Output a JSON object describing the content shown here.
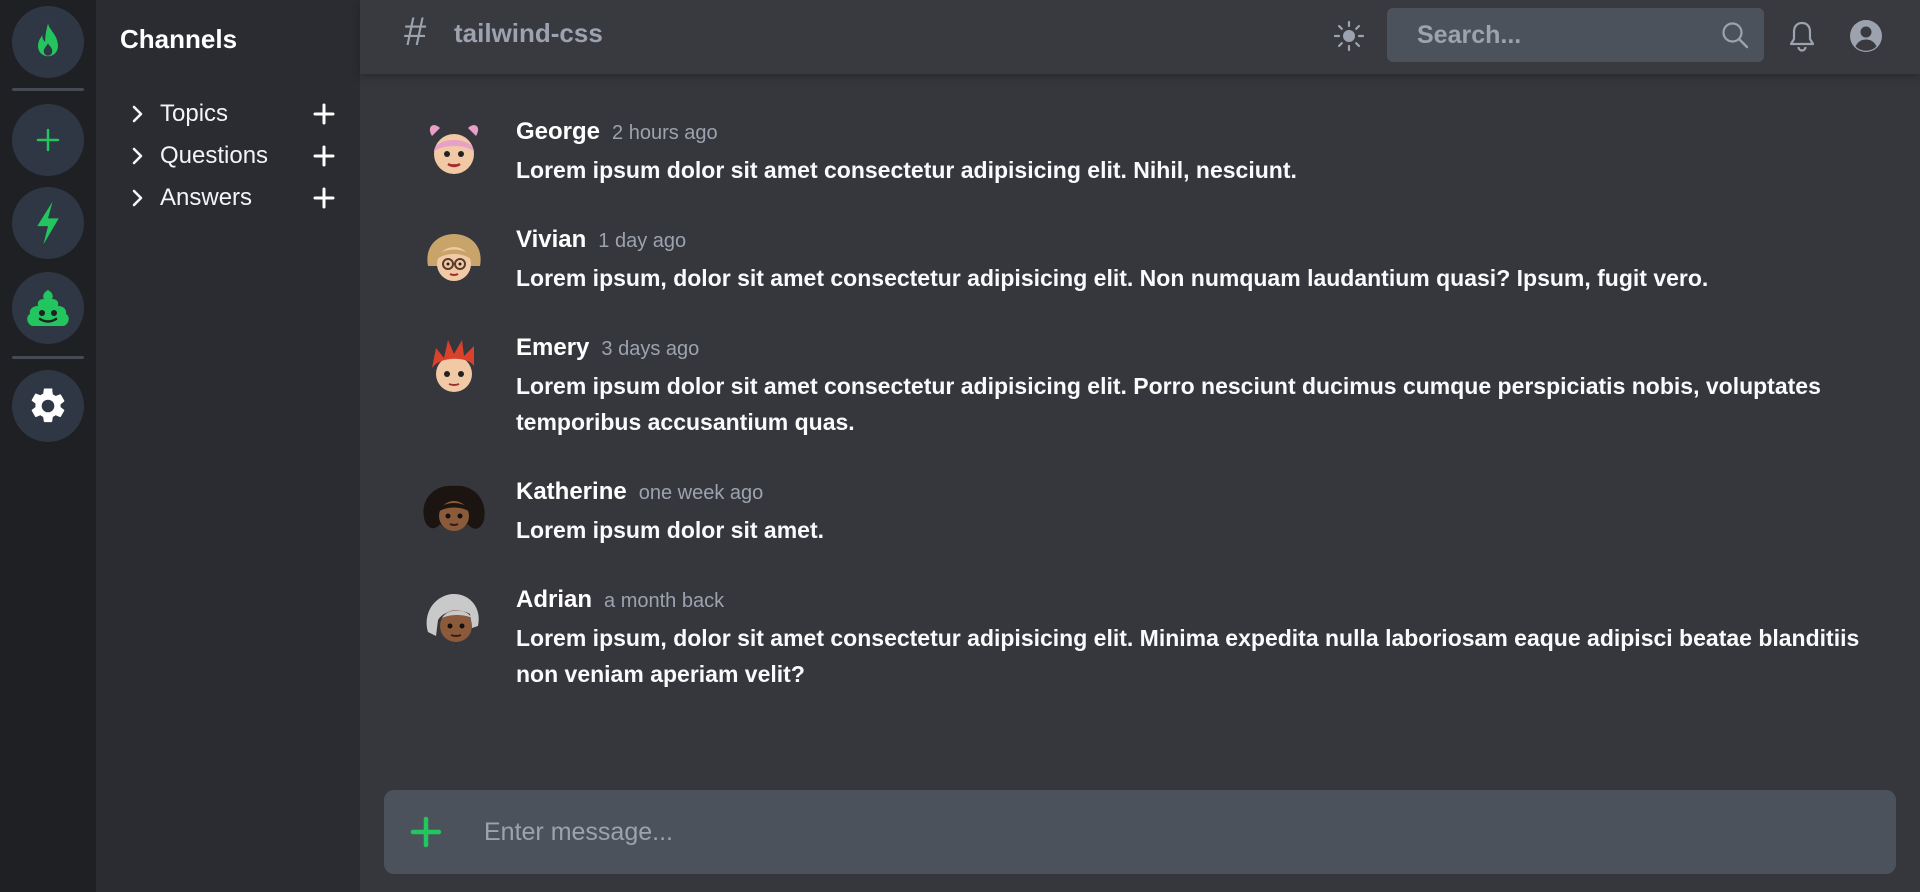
{
  "rail": {
    "icons": [
      "fire-icon",
      "plus-icon",
      "bolt-icon",
      "poo-icon",
      "gear-icon"
    ],
    "accent": "#22c55e"
  },
  "sidebar": {
    "title": "Channels",
    "items": [
      {
        "label": "Topics"
      },
      {
        "label": "Questions"
      },
      {
        "label": "Answers"
      }
    ]
  },
  "header": {
    "hash": "#",
    "channel": "tailwind-css",
    "search_placeholder": "Search..."
  },
  "messages": [
    {
      "author": "George",
      "time": "2 hours ago",
      "text": "Lorem ipsum dolor sit amet consectetur adipisicing elit. Nihil, nesciunt.",
      "avatar_hair": "#e8a0c8"
    },
    {
      "author": "Vivian",
      "time": "1 day ago",
      "text": "Lorem ipsum, dolor sit amet consectetur adipisicing elit. Non numquam laudantium quasi? Ipsum, fugit vero.",
      "avatar_hair": "#c8a46a"
    },
    {
      "author": "Emery",
      "time": "3 days ago",
      "text": "Lorem ipsum dolor sit amet consectetur adipisicing elit. Porro nesciunt ducimus cumque perspiciatis nobis, voluptates temporibus accusantium quas.",
      "avatar_hair": "#d9412b"
    },
    {
      "author": "Katherine",
      "time": "one week ago",
      "text": "Lorem ipsum dolor sit amet.",
      "avatar_hair": "#1c1410"
    },
    {
      "author": "Adrian",
      "time": "a month back",
      "text": "Lorem ipsum, dolor sit amet consectetur adipisicing elit. Minima expedita nulla laboriosam eaque adipisci beatae blanditiis non veniam aperiam velit?",
      "avatar_hair": "#c9c9c9"
    }
  ],
  "composer": {
    "placeholder": "Enter message..."
  }
}
